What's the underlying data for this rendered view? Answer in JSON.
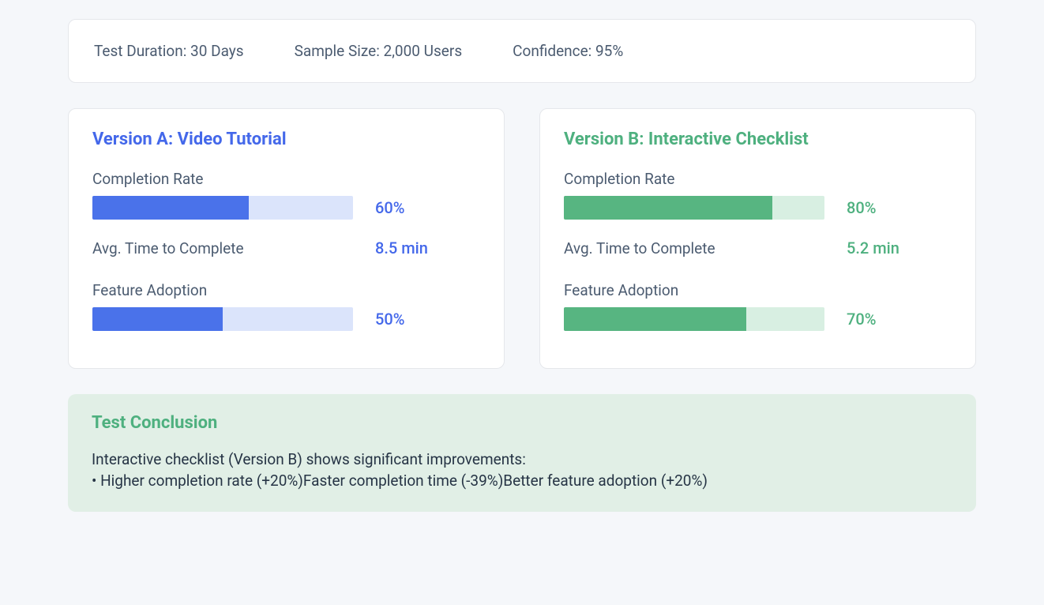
{
  "summary": {
    "duration": "Test Duration: 30 Days",
    "sample": "Sample Size: 2,000 Users",
    "confidence": "Confidence: 95%"
  },
  "versionA": {
    "title": "Version A: Video Tutorial",
    "completion_label": "Completion Rate",
    "completion_value": "60%",
    "completion_pct": 60,
    "time_label": "Avg. Time to Complete",
    "time_value": "8.5 min",
    "adoption_label": "Feature Adoption",
    "adoption_value": "50%",
    "adoption_pct": 50
  },
  "versionB": {
    "title": "Version B: Interactive Checklist",
    "completion_label": "Completion Rate",
    "completion_value": "80%",
    "completion_pct": 80,
    "time_label": "Avg. Time to Complete",
    "time_value": "5.2 min",
    "adoption_label": "Feature Adoption",
    "adoption_value": "70%",
    "adoption_pct": 70
  },
  "conclusion": {
    "title": "Test Conclusion",
    "lead": "Interactive checklist (Version B) shows significant improvements:",
    "bullets": "• Higher completion rate (+20%)Faster completion time (-39%)Better feature adoption (+20%)"
  },
  "chart_data": [
    {
      "type": "bar",
      "title": "Version A: Video Tutorial — Completion Rate",
      "categories": [
        "Completion Rate"
      ],
      "values": [
        60
      ],
      "ylim": [
        0,
        100
      ],
      "ylabel": "%"
    },
    {
      "type": "bar",
      "title": "Version A: Video Tutorial — Feature Adoption",
      "categories": [
        "Feature Adoption"
      ],
      "values": [
        50
      ],
      "ylim": [
        0,
        100
      ],
      "ylabel": "%"
    },
    {
      "type": "bar",
      "title": "Version B: Interactive Checklist — Completion Rate",
      "categories": [
        "Completion Rate"
      ],
      "values": [
        80
      ],
      "ylim": [
        0,
        100
      ],
      "ylabel": "%"
    },
    {
      "type": "bar",
      "title": "Version B: Interactive Checklist — Feature Adoption",
      "categories": [
        "Feature Adoption"
      ],
      "values": [
        70
      ],
      "ylim": [
        0,
        100
      ],
      "ylabel": "%"
    },
    {
      "type": "table",
      "title": "Avg. Time to Complete (minutes)",
      "categories": [
        "Version A",
        "Version B"
      ],
      "values": [
        8.5,
        5.2
      ]
    }
  ]
}
